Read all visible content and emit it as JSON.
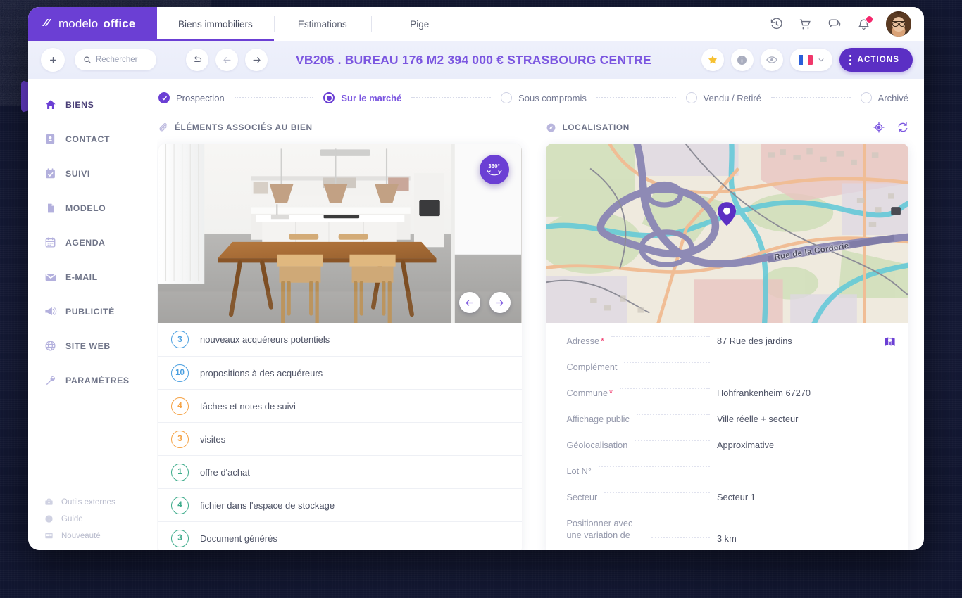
{
  "brand": {
    "word1": "modelo",
    "word2": "office",
    "logo_icon": "modelo-logo-icon"
  },
  "topnav": {
    "tabs": [
      {
        "label": "Biens immobiliers",
        "active": true
      },
      {
        "label": "Estimations",
        "active": false
      },
      {
        "label": "Pige",
        "active": false
      }
    ],
    "icons": [
      {
        "name": "history-icon"
      },
      {
        "name": "cart-icon"
      },
      {
        "name": "chat-icon"
      },
      {
        "name": "bell-icon",
        "badge": true
      }
    ],
    "avatar_alt": "user-avatar",
    "notification_color": "#f5276c"
  },
  "toolbar": {
    "add_label": "+",
    "search_placeholder": "Rechercher",
    "nav_back_to_list": "return-icon",
    "nav_prev": "arrow-left-icon",
    "nav_next": "arrow-right-icon",
    "title": "VB205 . BUREAU 176 M2 394 000 €  STRASBOURG CENTRE",
    "favorite_icon": "star-icon",
    "info_icon": "info-icon",
    "visibility_icon": "eye-icon",
    "language": "FR",
    "actions_label": "ACTIONS",
    "accent_color": "#6b3fd4",
    "title_color": "#7B56E0"
  },
  "sidebar": {
    "items": [
      {
        "label": "BIENS",
        "icon": "home-icon",
        "active": true
      },
      {
        "label": "CONTACT",
        "icon": "contact-card-icon",
        "active": false
      },
      {
        "label": "SUIVI",
        "icon": "calendar-check-icon",
        "active": false
      },
      {
        "label": "MODELO",
        "icon": "document-icon",
        "active": false
      },
      {
        "label": "AGENDA",
        "icon": "calendar-icon",
        "active": false
      },
      {
        "label": "E-MAIL",
        "icon": "envelope-icon",
        "active": false
      },
      {
        "label": "PUBLICITÉ",
        "icon": "megaphone-icon",
        "active": false
      },
      {
        "label": "SITE WEB",
        "icon": "globe-icon",
        "active": false
      },
      {
        "label": "PARAMÈTRES",
        "icon": "wrench-icon",
        "active": false
      }
    ],
    "footer": [
      {
        "label": "Outils externes",
        "icon": "toolbox-icon"
      },
      {
        "label": "Guide",
        "icon": "info-circle-icon"
      },
      {
        "label": "Nouveauté",
        "icon": "news-icon"
      }
    ]
  },
  "steps": [
    {
      "label": "Prospection",
      "state": "done"
    },
    {
      "label": "Sur le marché",
      "state": "active"
    },
    {
      "label": "Sous compromis",
      "state": "todo"
    },
    {
      "label": "Vendu / Retiré",
      "state": "todo"
    },
    {
      "label": "Archivé",
      "state": "todo"
    }
  ],
  "left_panel": {
    "title": "ÉLÉMENTS ASSOCIÉS AU BIEN",
    "icon": "paperclip-icon",
    "photo": {
      "badge_360": "360°",
      "prev": "arrow-left-icon",
      "next": "arrow-right-icon",
      "alt": "kitchen-dining-room-photo"
    },
    "items": [
      {
        "count": "3",
        "label": "nouveaux acquéreurs potentiels",
        "color": "#4a9fe0"
      },
      {
        "count": "10",
        "label": "propositions à des acquéreurs",
        "color": "#4a9fe0"
      },
      {
        "count": "4",
        "label": "tâches et notes de suivi",
        "color": "#f5a244"
      },
      {
        "count": "3",
        "label": "visites",
        "color": "#f5a244"
      },
      {
        "count": "1",
        "label": "offre d'achat",
        "color": "#3cab8a"
      },
      {
        "count": "4",
        "label": "fichier dans l'espace de stockage",
        "color": "#3cab8a"
      },
      {
        "count": "3",
        "label": "Document générés",
        "color": "#3cab8a"
      }
    ]
  },
  "right_panel": {
    "title": "LOCALISATION",
    "icon": "location-icon",
    "header_actions": [
      {
        "name": "recenter-icon"
      },
      {
        "name": "refresh-icon"
      }
    ],
    "map": {
      "street_label": "Rue de la Corderie",
      "pin": "map-pin-icon"
    },
    "fields": [
      {
        "label": "Adresse",
        "required": true,
        "value": "87 Rue des jardins",
        "action_icon": "open-map-icon"
      },
      {
        "label": "Complément",
        "required": false,
        "value": ""
      },
      {
        "label": "Commune",
        "required": true,
        "value": "Hohfrankenheim 67270"
      },
      {
        "label": "Affichage public",
        "required": false,
        "value": "Ville réelle + secteur"
      },
      {
        "label": "Géolocalisation",
        "required": false,
        "value": "Approximative"
      },
      {
        "label": "Lot N°",
        "required": false,
        "value": ""
      },
      {
        "label": "Secteur",
        "required": false,
        "value": "Secteur 1"
      },
      {
        "label": "Positionner avec une variation de",
        "required": false,
        "value": "3 km",
        "multiline": true
      }
    ]
  }
}
